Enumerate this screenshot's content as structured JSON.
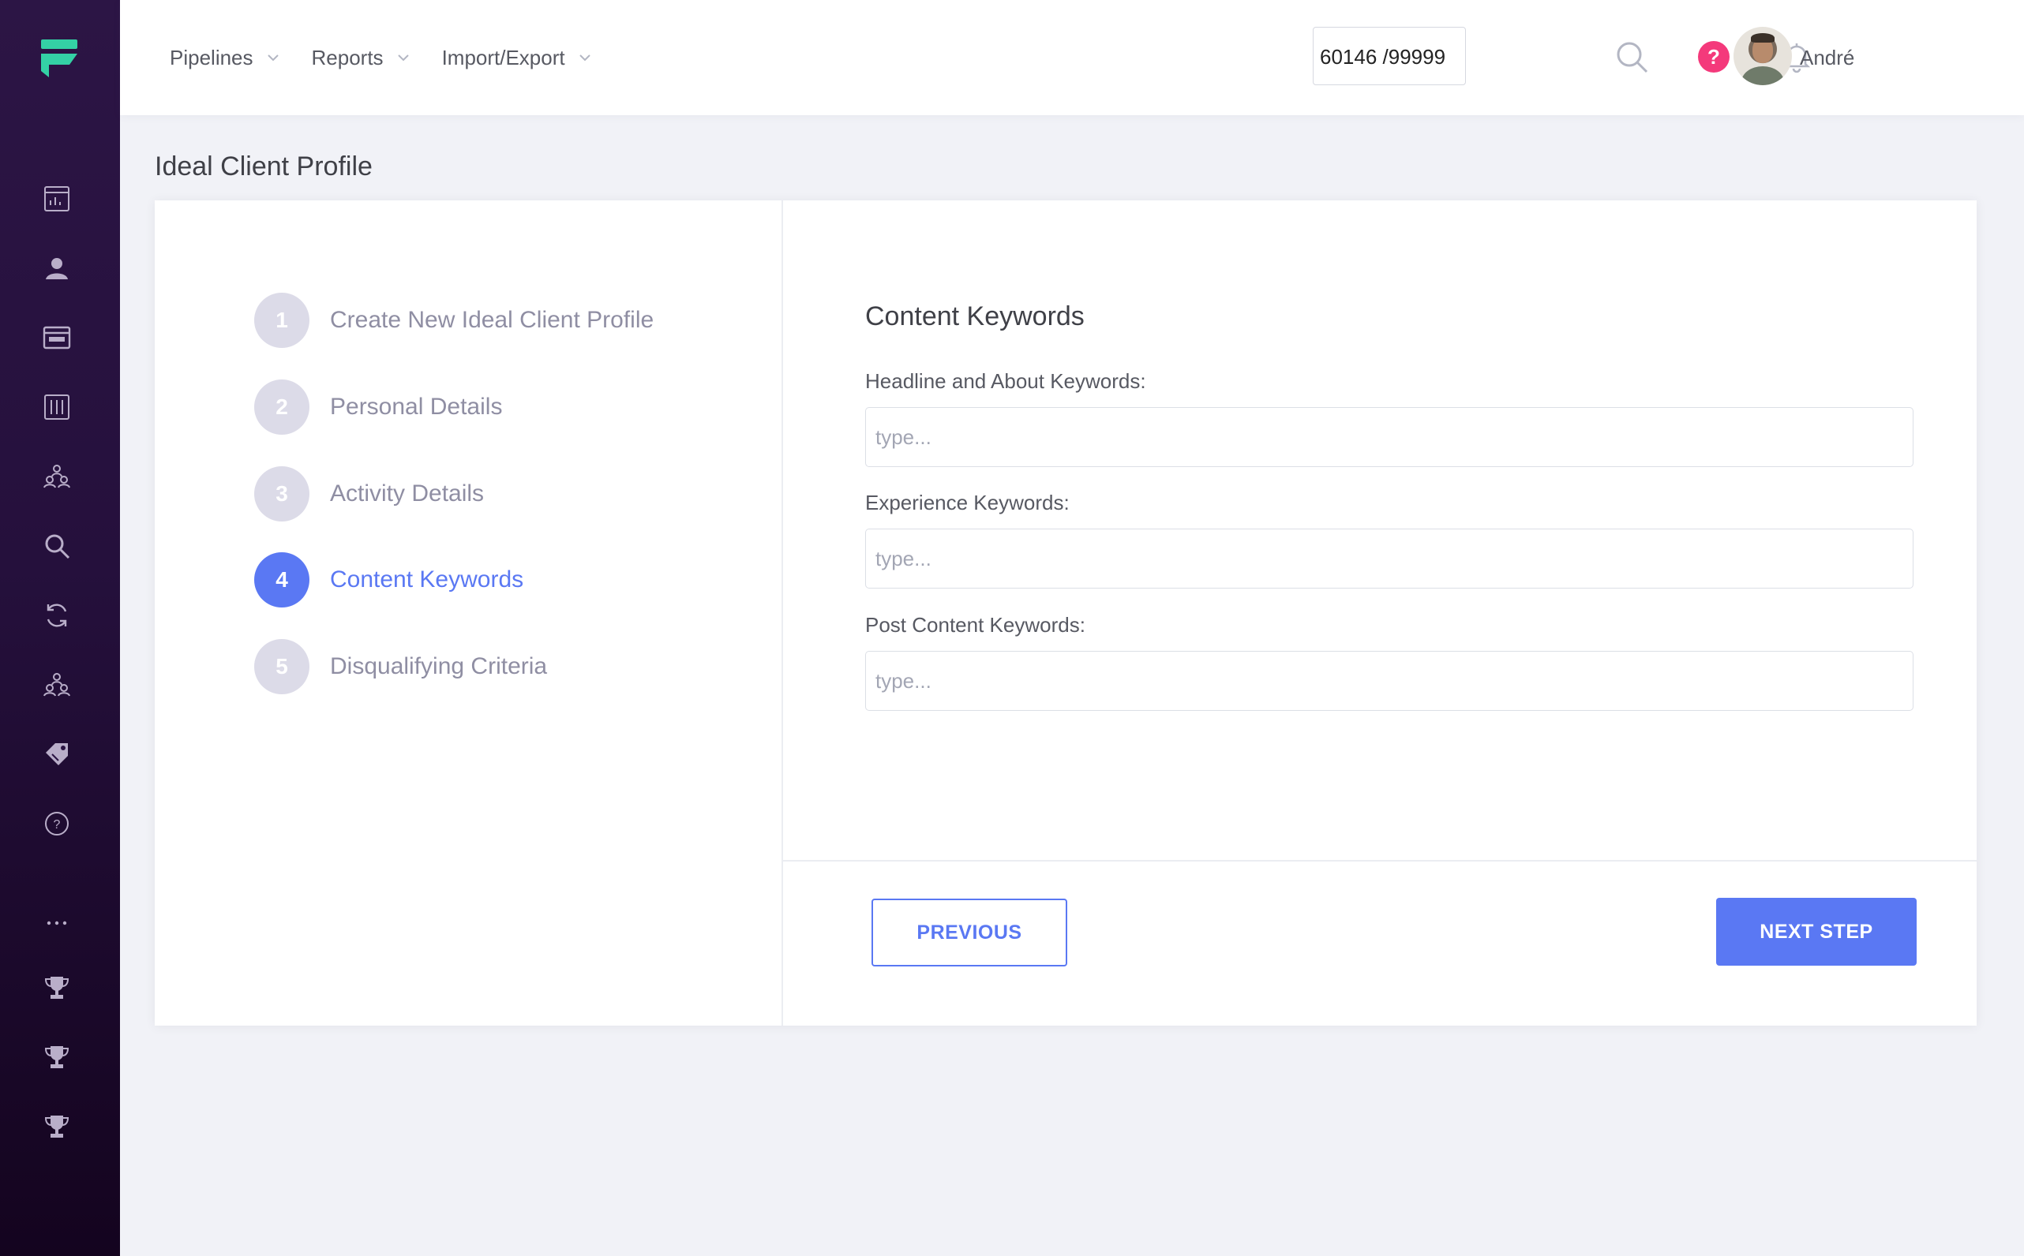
{
  "colors": {
    "accent": "#5a78f3",
    "logo": "#34d1a5",
    "help_badge": "#f4397b",
    "sidebar_bg": "#2c1545"
  },
  "header": {
    "nav": [
      {
        "label": "Pipelines",
        "icon": "chevron-down-icon"
      },
      {
        "label": "Reports",
        "icon": "chevron-down-icon"
      },
      {
        "label": "Import/Export",
        "icon": "chevron-down-icon"
      }
    ],
    "counter_text": "60146 /99999",
    "help_label": "?",
    "user_name": "André"
  },
  "sidebar": {
    "logo": "app-logo",
    "icons": [
      "dashboard-icon",
      "contacts-icon",
      "browser-window-icon",
      "columns-board-icon",
      "team-icon",
      "search-icon",
      "sync-icon",
      "group-icon",
      "tag-icon",
      "help-circle-icon",
      "more-dots-icon",
      "trophy-icon",
      "trophy-icon",
      "trophy-icon"
    ]
  },
  "page": {
    "title": "Ideal Client Profile"
  },
  "wizard": {
    "steps": [
      {
        "number": "1",
        "label": "Create New Ideal Client Profile"
      },
      {
        "number": "2",
        "label": "Personal Details"
      },
      {
        "number": "3",
        "label": "Activity Details"
      },
      {
        "number": "4",
        "label": "Content Keywords",
        "active": true
      },
      {
        "number": "5",
        "label": "Disqualifying Criteria"
      }
    ]
  },
  "form": {
    "title": "Content Keywords",
    "fields": [
      {
        "label": "Headline and About Keywords:",
        "value": "",
        "placeholder": "type..."
      },
      {
        "label": "Experience Keywords:",
        "value": "",
        "placeholder": "type..."
      },
      {
        "label": "Post Content Keywords:",
        "value": "",
        "placeholder": "type..."
      }
    ],
    "previous_label": "PREVIOUS",
    "next_label": "NEXT STEP"
  }
}
